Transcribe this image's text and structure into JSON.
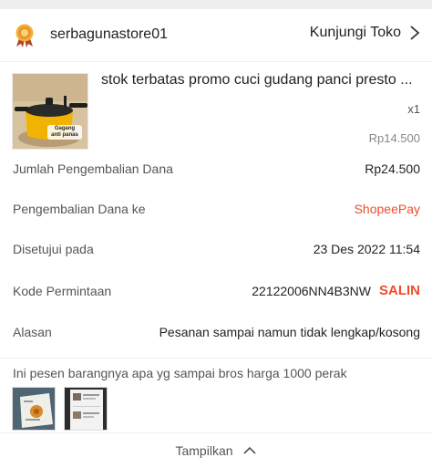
{
  "store": {
    "name": "serbagunastore01",
    "badge_icon": "shop-badge-icon",
    "visit_label": "Kunjungi Toko"
  },
  "product": {
    "title": "stok terbatas promo cuci gudang panci presto ...",
    "quantity": "x1",
    "price": "Rp14.500",
    "image_caption": "Gagang anti panas"
  },
  "details": {
    "refund_amount_label": "Jumlah Pengembalian Dana",
    "refund_amount_value": "Rp24.500",
    "refund_to_label": "Pengembalian Dana ke",
    "refund_to_value": "ShopeePay",
    "approved_label": "Disetujui pada",
    "approved_value": "23 Des 2022 11:54",
    "request_code_label": "Kode Permintaan",
    "request_code_value": "22122006NN4B3NW",
    "copy_label": "SALIN",
    "reason_label": "Alasan",
    "reason_value": "Pesanan sampai namun tidak lengkap/kosong"
  },
  "note": {
    "text": "Ini pesen barangnya apa yg sampai bros harga 1000 perak"
  },
  "footer": {
    "toggle_label": "Tampilkan"
  },
  "colors": {
    "accent": "#ee4d2d",
    "text": "#222222",
    "muted": "#555555"
  }
}
